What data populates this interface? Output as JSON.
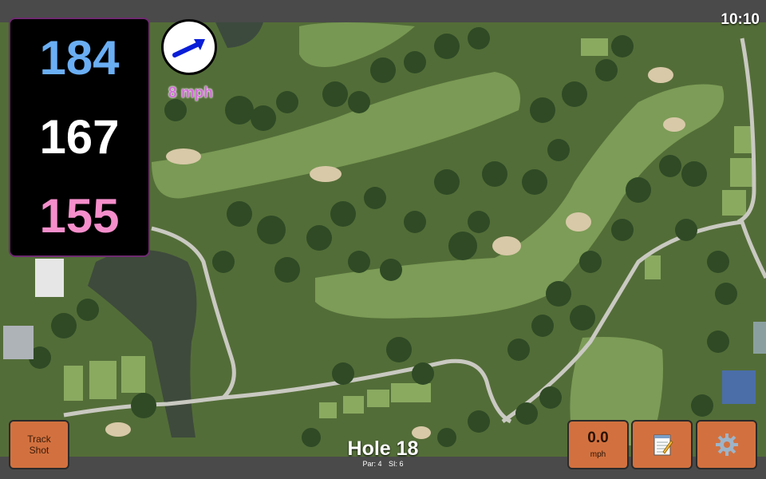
{
  "status_bar": {
    "time": "10:10"
  },
  "distances": {
    "back": "184",
    "middle": "167",
    "front": "155"
  },
  "wind": {
    "speed_label": "8 mph",
    "direction_icon": "wind-arrow-icon"
  },
  "hole": {
    "title": "Hole 18",
    "par": "Par: 4",
    "si": "SI: 6"
  },
  "buttons": {
    "track_shot_line1": "Track",
    "track_shot_line2": "Shot",
    "speed_value": "0.0",
    "speed_unit": "mph",
    "notes_icon": "notepad-icon",
    "settings_icon": "gear-icon"
  },
  "colors": {
    "back_distance": "#6aaef3",
    "middle_distance": "#ffffff",
    "front_distance": "#f58ecb",
    "button_bg": "#d2713f",
    "wind_label": "#d26fd6",
    "panel_border": "#6e2a70"
  }
}
